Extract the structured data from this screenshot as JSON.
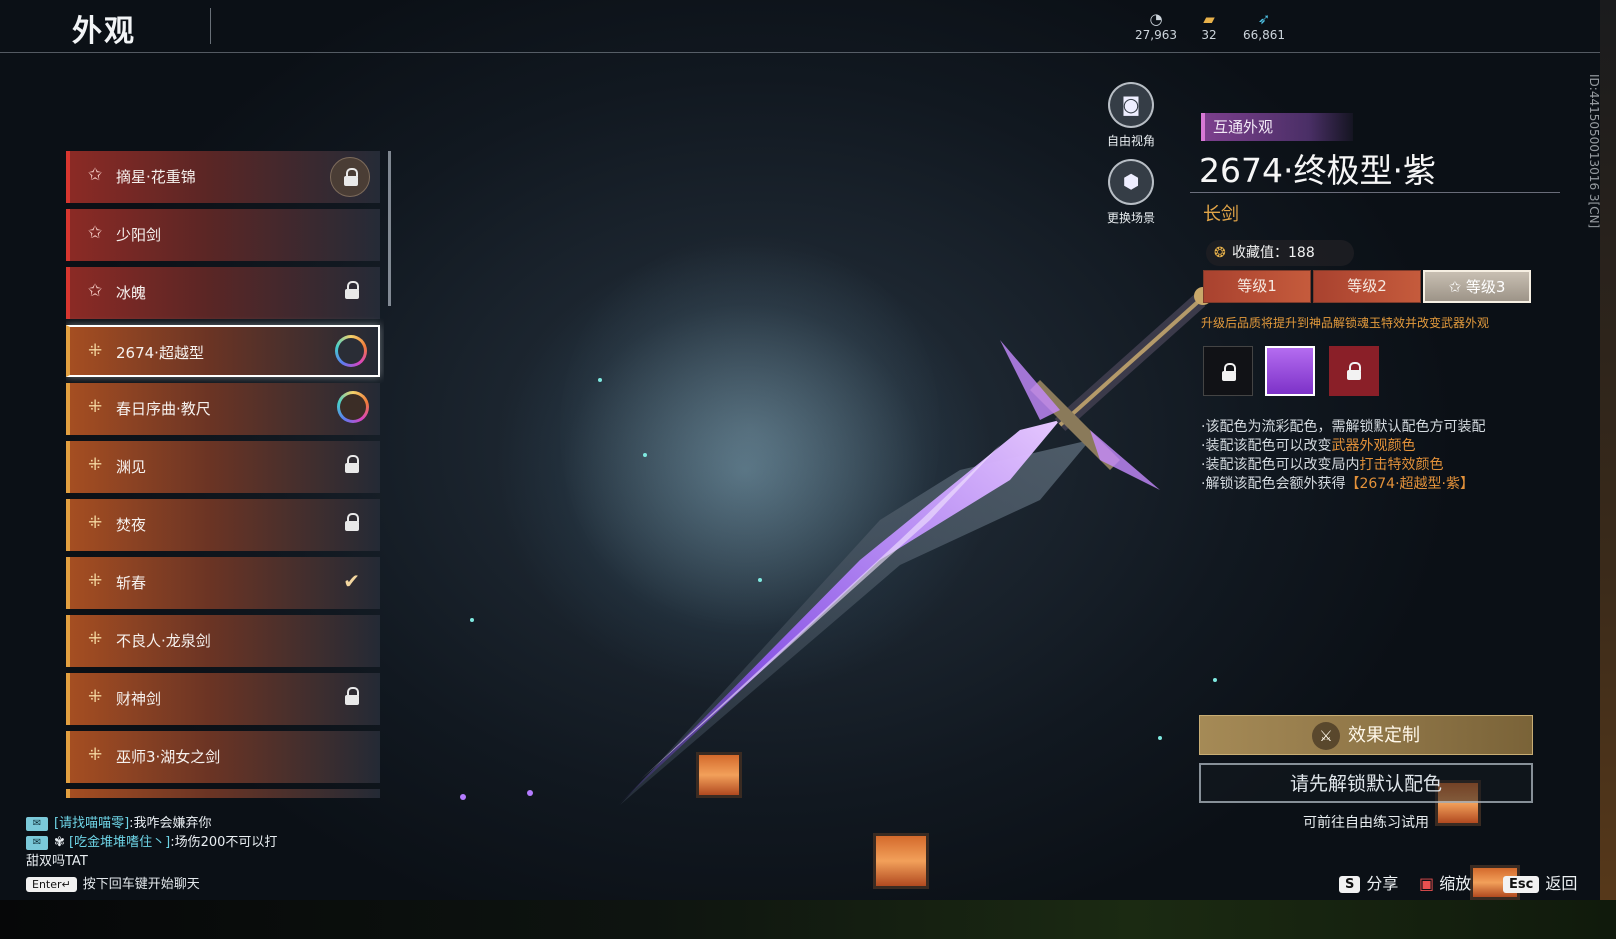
{
  "header": {
    "title": "外观",
    "currencies": [
      {
        "icon": "coin-icon",
        "value": "27,963"
      },
      {
        "icon": "ticket-icon",
        "value": "32"
      },
      {
        "icon": "feather-icon",
        "value": "66,861"
      }
    ]
  },
  "side_buttons": {
    "free_view": "自由视角",
    "change_scene": "更换场景"
  },
  "list": {
    "items": [
      {
        "label": "摘星·花重锦",
        "rarity": "red",
        "status": "locked-badge"
      },
      {
        "label": "少阳剑",
        "rarity": "red",
        "status": "none"
      },
      {
        "label": "冰魄",
        "rarity": "red",
        "status": "locked"
      },
      {
        "label": "2674·超越型",
        "rarity": "gold",
        "status": "ring",
        "selected": true
      },
      {
        "label": "春日序曲·教尺",
        "rarity": "gold",
        "status": "ring"
      },
      {
        "label": "渊见",
        "rarity": "gold",
        "status": "locked"
      },
      {
        "label": "焚夜",
        "rarity": "gold",
        "status": "locked"
      },
      {
        "label": "斩春",
        "rarity": "gold",
        "status": "equipped"
      },
      {
        "label": "不良人·龙泉剑",
        "rarity": "gold",
        "status": "none"
      },
      {
        "label": "财神剑",
        "rarity": "gold",
        "status": "locked"
      },
      {
        "label": "巫师3·湖女之剑",
        "rarity": "gold",
        "status": "none"
      }
    ]
  },
  "detail": {
    "tag": "互通外观",
    "name": "2674·终极型·紫",
    "type": "长剑",
    "collection": "收藏值：188",
    "levels": [
      "等级1",
      "等级2",
      "等级3"
    ],
    "active_level": "等级3",
    "upgrade_hint": "升级后品质将提升到神品解锁魂玉特效并改变武器外观",
    "swatches": [
      {
        "color": "#111216",
        "locked": true
      },
      {
        "color": "#9b4fe0",
        "locked": false
      },
      {
        "color": "#8a1f28",
        "locked": true
      }
    ],
    "notes": {
      "n1": "·该配色为流彩配色，需解锁默认配色方可装配",
      "n2_pre": "·装配该配色可以改变",
      "n2_hl": "武器外观颜色",
      "n3_pre": "·装配该配色可以改变局内",
      "n3_hl": "打击特效颜色",
      "n4_pre": "·解锁该配色会额外获得",
      "n4_hl": "【2674·超越型·紫】"
    },
    "custom_button": "效果定制",
    "unlock_button": "请先解锁默认配色",
    "trial_hint": "可前往自由练习试用",
    "uid": "ID:4415050013016 3[CN]"
  },
  "chat": {
    "lines": [
      {
        "channel": "队",
        "name": "[请找喵喵零]",
        "text": ":我咋会嫌弃你"
      },
      {
        "channel": "队",
        "name": "[吃金堆堆嗜住丶]",
        "text": ":场伤200不可以打"
      },
      {
        "channel": "",
        "name": "",
        "text": "甜双吗TAT"
      }
    ],
    "enter_key": "Enter↵",
    "tip": "按下回车键开始聊天"
  },
  "bottom_hints": {
    "share_key": "S",
    "share": "分享",
    "zoom": "缩放",
    "back_key": "Esc",
    "back": "返回"
  },
  "colors": {
    "accent_gold": "#e2a548",
    "accent_red": "#d8362f",
    "accent_purple": "#9b4fe0"
  }
}
